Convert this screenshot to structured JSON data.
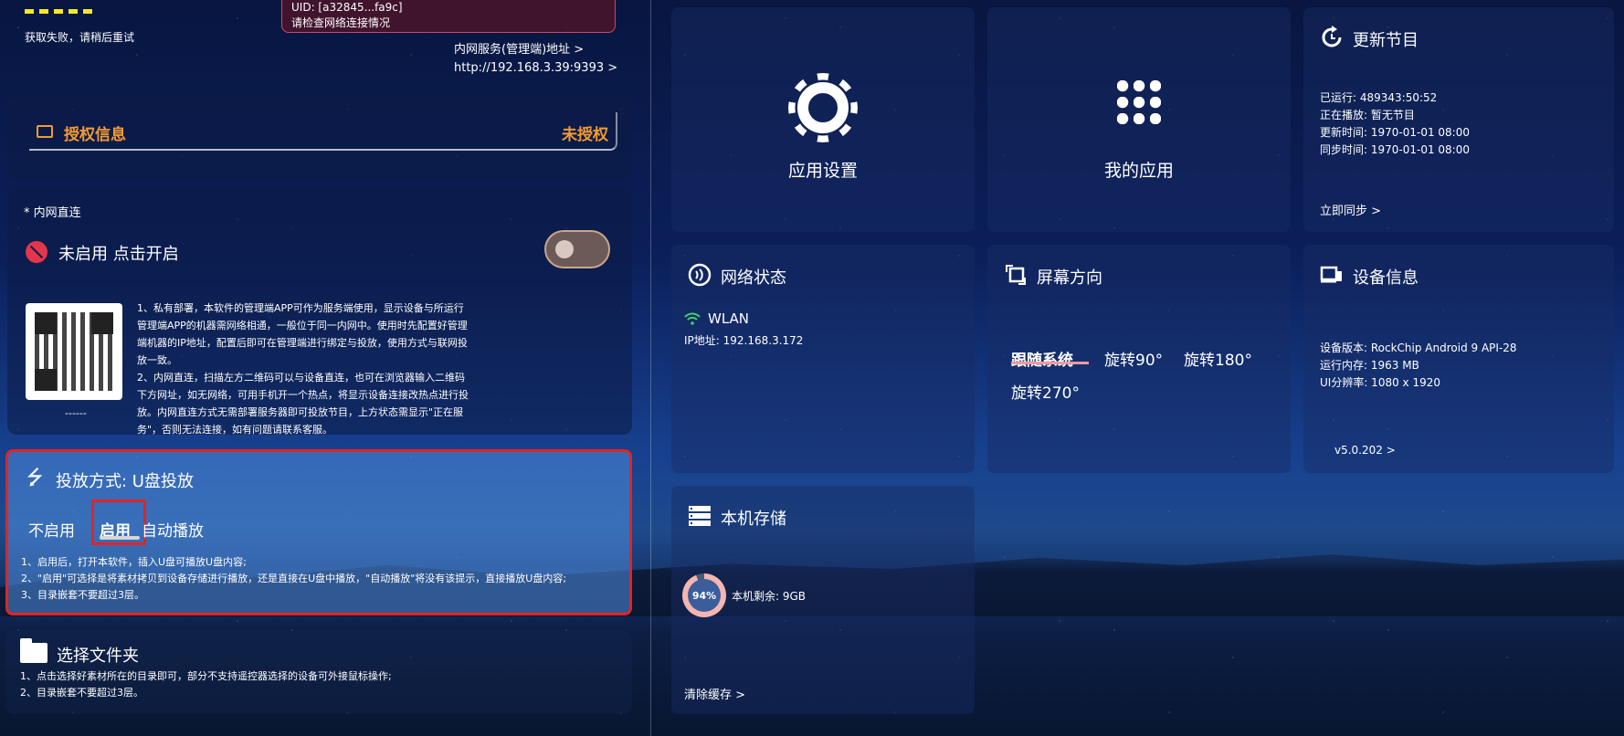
{
  "top_left": {
    "fail_text": "获取失败，请稍后重试",
    "uid_line": "UID: [a32845...fa9c]",
    "network_hint": "请检查网络连接情况",
    "intranet_label": "内网服务(管理端)地址 >",
    "intranet_url": "http://192.168.3.39:9393 >"
  },
  "auth": {
    "title": "授权信息",
    "status": "未授权"
  },
  "lan": {
    "label": "* 内网直连",
    "status": "未启用 点击开启",
    "qr_caption": "------",
    "desc": [
      "1、私有部署，本软件的管理端APP可作为服务端使用，显示设备与所运行",
      "管理端APP的机器需网络相通，一般位于同一内网中。使用时先配置好管理",
      "端机器的IP地址，配置后即可在管理端进行绑定与投放，使用方式与联网投",
      "放一致。",
      "2、内网直连，扫描左方二维码可以与设备直连，也可在浏览器输入二维码",
      "下方网址，如无网络，可用手机开一个热点，将显示设备连接改热点进行投",
      "放。内网直连方式无需部署服务器即可投放节目，上方状态需显示\"正在服",
      "务\"，否则无法连接，如有问题请联系客服。"
    ]
  },
  "usb": {
    "title": "投放方式: U盘投放",
    "options": [
      "不启用",
      "启用",
      "自动播放"
    ],
    "selected": "启用",
    "desc": [
      "1、启用后，打开本软件，插入U盘可播放U盘内容;",
      "2、\"启用\"可选择是将素材拷贝到设备存储进行播放，还是直接在U盘中播放，\"自动播放\"将没有该提示，直接播放U盘内容;",
      "3、目录嵌套不要超过3层。"
    ]
  },
  "folder": {
    "title": "选择文件夹",
    "desc": [
      "1、点击选择好素材所在的目录即可，部分不支持遥控器选择的设备可外接鼠标操作;",
      "2、目录嵌套不要超过3层。"
    ]
  },
  "tiles": {
    "app_settings": "应用设置",
    "my_apps": "我的应用",
    "update": {
      "title": "更新节目",
      "lines": [
        "已运行: 489343:50:52",
        "正在播放: 暂无节目",
        "更新时间: 1970-01-01 08:00",
        "同步时间: 1970-01-01 08:00"
      ],
      "sync": "立即同步 >"
    },
    "network": {
      "title": "网络状态",
      "type": "WLAN",
      "ip": "IP地址: 192.168.3.172"
    },
    "rotation": {
      "title": "屏幕方向",
      "options": [
        "跟随系统",
        "旋转90°",
        "旋转180°",
        "旋转270°"
      ],
      "selected": "跟随系统"
    },
    "device": {
      "title": "设备信息",
      "lines": [
        "设备版本: RockChip Android 9 API-28",
        "运行内存: 1963 MB",
        "UI分辨率: 1080 x 1920"
      ],
      "version": "v5.0.202  >"
    },
    "storage": {
      "title": "本机存储",
      "percent": "94%",
      "percent_value": 94,
      "remaining": "本机剩余: 9GB",
      "clear": "清除缓存 >"
    }
  },
  "colors": {
    "accent_orange": "#f39a32",
    "highlight_red": "#e02424",
    "toggle_off": "#6b5a58"
  }
}
